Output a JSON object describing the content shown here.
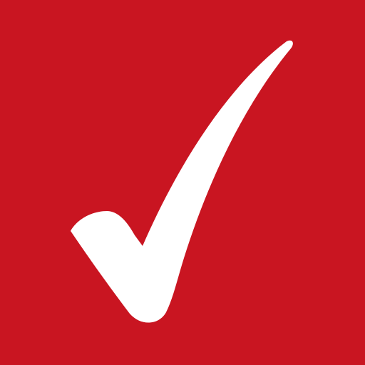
{
  "icon": {
    "name": "checkmark-icon",
    "background_color": "#C91521",
    "mark_color": "#FFFFFF"
  }
}
